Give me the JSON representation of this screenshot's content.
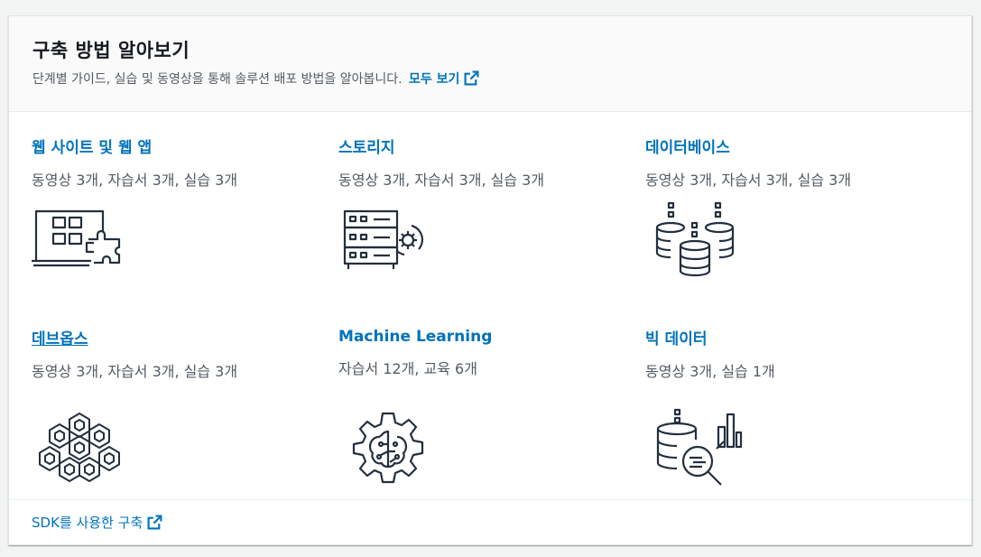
{
  "header": {
    "title": "구축 방법 알아보기",
    "description": "단계별 가이드, 실습 및 동영상을 통해 솔루션 배포 방법을 알아봅니다.",
    "view_all_label": "모두 보기"
  },
  "items": [
    {
      "title": "웹 사이트 및 웹 앱",
      "meta": "동영상 3개, 자습서 3개, 실습 3개",
      "icon": "website-app-icon"
    },
    {
      "title": "스토리지",
      "meta": "동영상 3개, 자습서 3개, 실습 3개",
      "icon": "storage-server-icon"
    },
    {
      "title": "데이터베이스",
      "meta": "동영상 3개, 자습서 3개, 실습 3개",
      "icon": "database-icon"
    },
    {
      "title": "데브옵스",
      "meta": "동영상 3개, 자습서 3개, 실습 3개",
      "icon": "devops-hexagon-icon"
    },
    {
      "title": "Machine Learning",
      "meta": "자습서 12개, 교육 6개",
      "icon": "machine-learning-gear-icon"
    },
    {
      "title": "빅 데이터",
      "meta": "동영상 3개, 실습 1개",
      "icon": "big-data-icon"
    }
  ],
  "footer": {
    "link_label": "SDK를 사용한 구축"
  },
  "colors": {
    "link": "#0073bb",
    "text": "#16191f",
    "muted": "#545b64",
    "icon": "#232f3e"
  }
}
